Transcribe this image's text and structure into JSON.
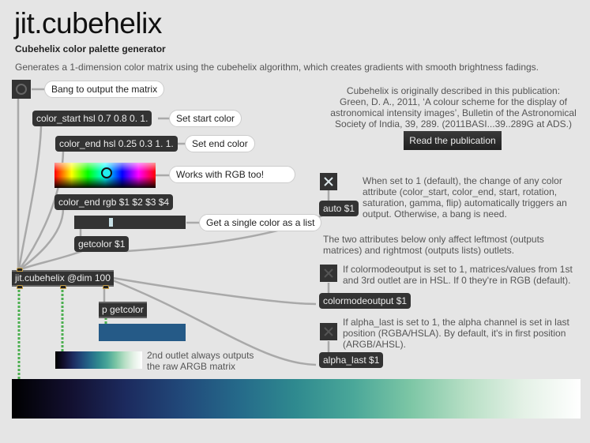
{
  "header": {
    "title": "jit.cubehelix",
    "subtitle": "Cubehelix color palette generator",
    "description": "Generates a 1-dimension color matrix using the cubehelix algorithm, which creates gradients with smooth brightness fadings."
  },
  "publication": {
    "lines": [
      "Cubehelix is originally described in this publication:",
      "Green, D. A., 2011, ‘A colour scheme for the display of",
      "astronomical intensity images’, Bulletin of the Astronomical",
      "Society of India, 39, 289. (2011BASI...39..289G at ADS.)"
    ],
    "button_label": "Read the publication"
  },
  "patch": {
    "bang_comment": "Bang to output the matrix",
    "color_start_msg": "color_start hsl 0.7 0.8 0. 1.",
    "color_start_comment": "Set start color",
    "color_end_msg": "color_end hsl 0.25 0.3 1. 1.",
    "color_end_comment": "Set end color",
    "swatch_comment": "Works with RGB too!",
    "color_end_rgb_msg": "color_end rgb $1 $2 $3 $4",
    "slider_comment": "Get a single color as a list",
    "getcolor_msg": "getcolor $1",
    "main_object": "jit.cubehelix @dim 100",
    "subpatch_object": "p getcolor",
    "selected_color": "#255a87",
    "second_outlet_note": [
      "2nd outlet always outputs",
      "the raw ARGB matrix"
    ]
  },
  "attributes": {
    "auto": {
      "toggle_state": "on",
      "msg": "auto $1",
      "note": [
        "When set to 1 (default), the change of any color",
        "attribute (color_start, color_end, start, rotation,",
        "saturation, gamma, flip) automatically triggers an",
        "output. Otherwise, a bang is need."
      ]
    },
    "outlets_note": [
      "The two attributes below only affect leftmost (outputs",
      "matrices) and rightmost (outputs lists) outlets."
    ],
    "colormodeoutput": {
      "toggle_state": "off",
      "msg": "colormodeoutput $1",
      "note": [
        "If colormodeoutput is set to 1, matrices/values from 1st",
        "and 3rd outlet are in HSL. If 0 they're in RGB (default)."
      ]
    },
    "alpha_last": {
      "toggle_state": "off",
      "msg": "alpha_last $1",
      "note": [
        "If alpha_last is set to 1, the alpha channel is set in last",
        "position (RGBA/HSLA). By default, it's in first position",
        "(ARGB/AHSL)."
      ]
    }
  },
  "gradient": {
    "stops": [
      "#000000",
      "#120f2e",
      "#1c2a5e",
      "#21497a",
      "#256a8a",
      "#2f8a8f",
      "#4aa799",
      "#7cc6a5",
      "#b7dfc5",
      "#e4f1e6",
      "#ffffff"
    ]
  }
}
